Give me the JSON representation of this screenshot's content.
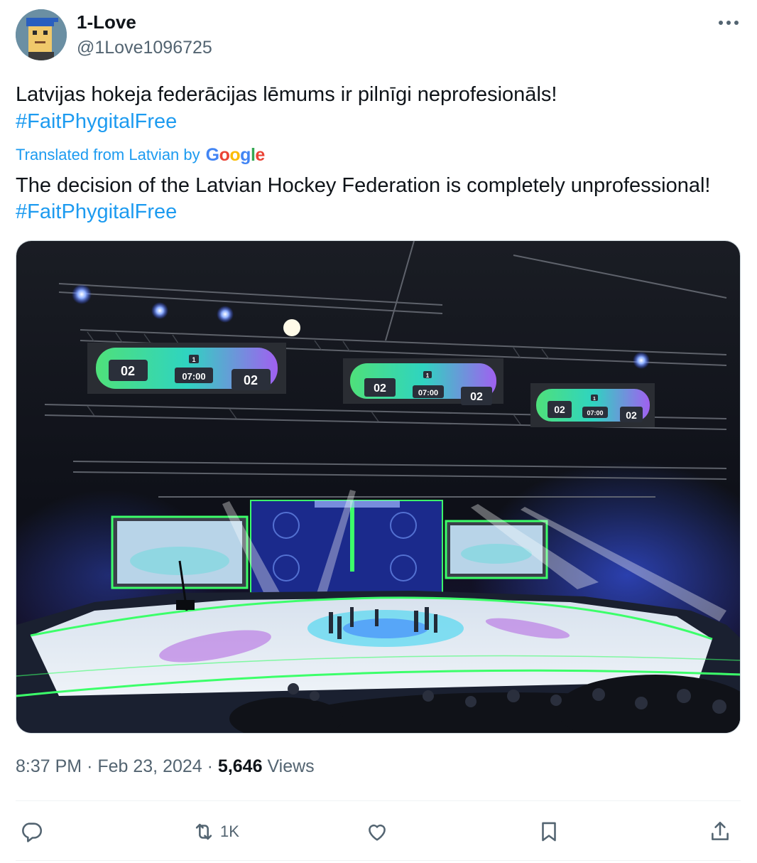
{
  "author": {
    "name": "1-Love",
    "handle": "@1Love1096725"
  },
  "tweet": {
    "text_plain": "Latvijas hokeja federācijas lēmums ir pilnīgi neprofesionāls!",
    "hashtag": "#FaitPhygitalFree",
    "translated_label": "Translated from Latvian by",
    "translator": "Google",
    "translation_plain": "The decision of the Latvian Hockey Federation is completely unprofessional!",
    "translation_hashtag": "#FaitPhygitalFree"
  },
  "media": {
    "scoreboards": [
      {
        "left_score": "02",
        "time": "07:00",
        "right_score": "02",
        "period": "1"
      },
      {
        "left_score": "02",
        "time": "07:00",
        "right_score": "02",
        "period": "1"
      },
      {
        "left_score": "02",
        "time": "07:00",
        "right_score": "02",
        "period": "1"
      }
    ]
  },
  "meta": {
    "time": "8:37 PM",
    "separator": "·",
    "date": "Feb 23, 2024",
    "views_count": "5,646",
    "views_label": "Views"
  },
  "actions": {
    "reply": {
      "icon": "reply-icon",
      "count": ""
    },
    "retweet": {
      "icon": "retweet-icon",
      "count": "1K"
    },
    "like": {
      "icon": "heart-icon",
      "count": ""
    },
    "bookmark": {
      "icon": "bookmark-icon",
      "count": ""
    },
    "share": {
      "icon": "share-icon",
      "count": ""
    }
  },
  "colors": {
    "accent": "#1d9bf0",
    "secondary_text": "#536471",
    "primary_text": "#0f1419",
    "divider": "#eff3f4"
  }
}
